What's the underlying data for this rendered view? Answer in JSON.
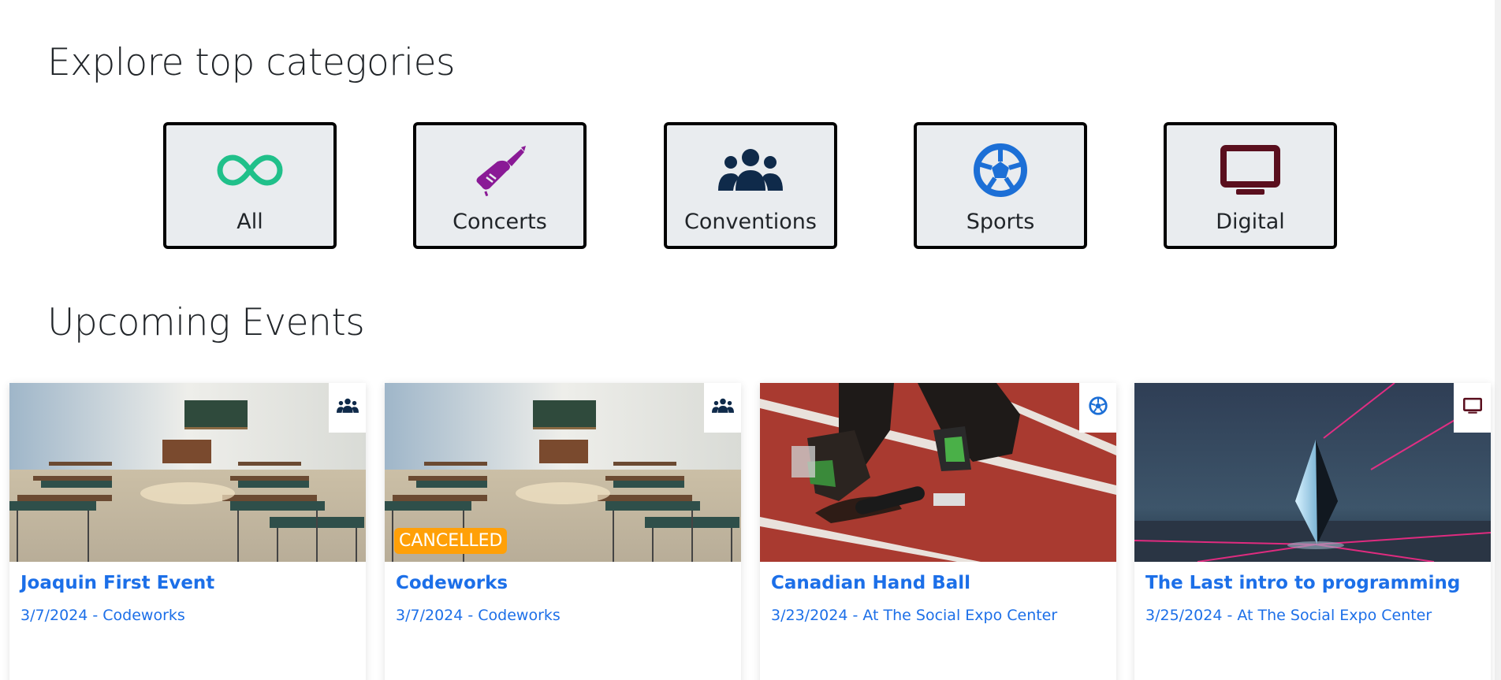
{
  "categories_section": {
    "title": "Explore top categories",
    "items": [
      {
        "label": "All",
        "icon": "infinity-icon",
        "color": "#20c08a"
      },
      {
        "label": "Concerts",
        "icon": "guitar-icon",
        "color": "#8a1a96"
      },
      {
        "label": "Conventions",
        "icon": "people-group-icon",
        "color": "#0f2a4a"
      },
      {
        "label": "Sports",
        "icon": "soccer-ball-icon",
        "color": "#1c6fd6"
      },
      {
        "label": "Digital",
        "icon": "monitor-icon",
        "color": "#5a0f1e"
      }
    ]
  },
  "events_section": {
    "title": "Upcoming Events",
    "events": [
      {
        "title": "Joaquin First Event",
        "date": "3/7/2024",
        "location": "Codeworks",
        "subtitle": "3/7/2024 - Codeworks",
        "type_icon": "people-group-icon",
        "image": "classroom",
        "cancelled": false
      },
      {
        "title": "Codeworks",
        "date": "3/7/2024",
        "location": "Codeworks",
        "subtitle": "3/7/2024 - Codeworks",
        "type_icon": "people-group-icon",
        "image": "classroom",
        "cancelled": true,
        "cancelled_label": "CANCELLED"
      },
      {
        "title": "Canadian Hand Ball",
        "date": "3/23/2024",
        "location": "At The Social Expo Center",
        "subtitle": "3/23/2024 - At The Social Expo Center",
        "type_icon": "soccer-ball-icon",
        "image": "track-runner",
        "cancelled": false
      },
      {
        "title": "The Last intro to programming",
        "date": "3/25/2024",
        "location": "At The Social Expo Center",
        "subtitle": "3/25/2024 - At The Social Expo Center",
        "type_icon": "monitor-icon",
        "image": "crystal",
        "cancelled": false
      }
    ]
  },
  "colors": {
    "link": "#1c6fe8",
    "card_bg": "#e9ecef",
    "cancelled": "#ffa008"
  }
}
